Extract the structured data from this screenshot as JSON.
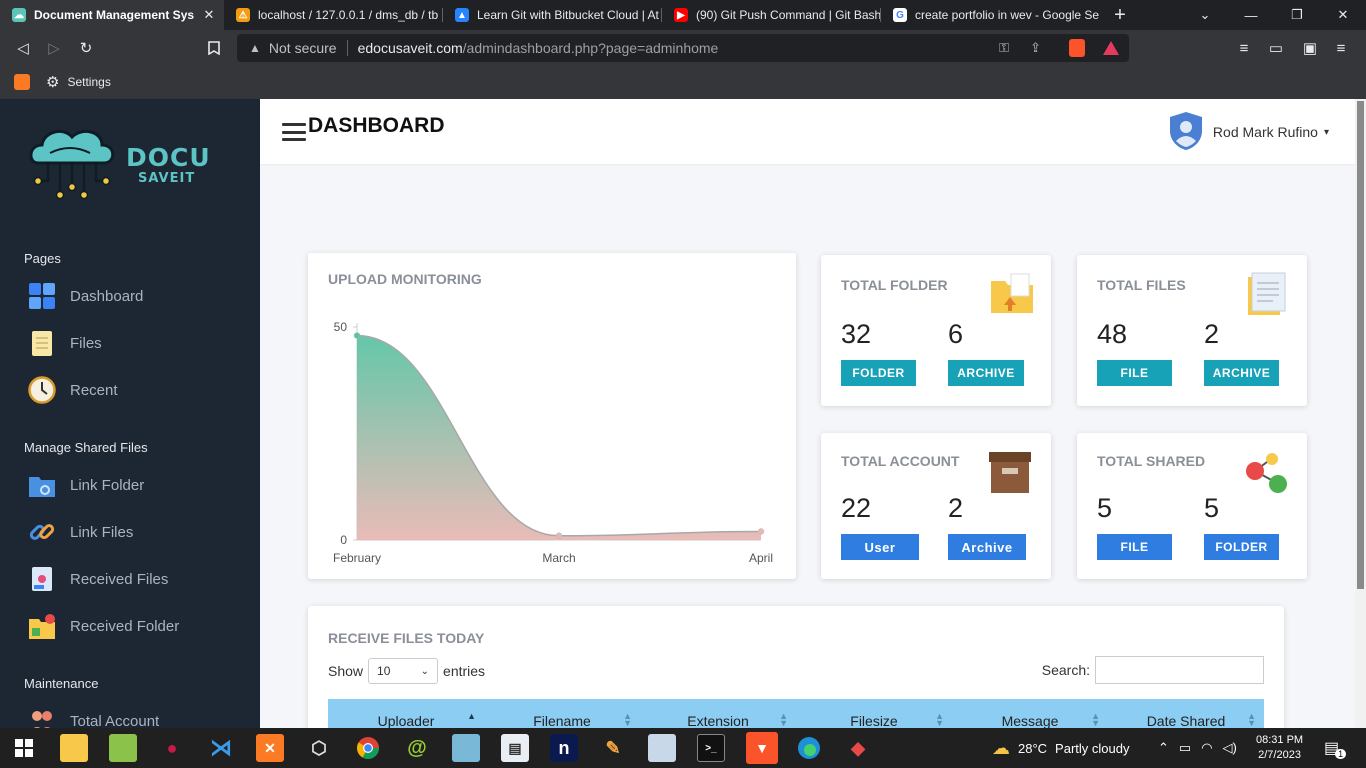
{
  "browser": {
    "tabs": [
      {
        "title": "Document Management Syste",
        "active": true,
        "icon": "cloud-favicon",
        "color": "#5cc4b8"
      },
      {
        "title": "localhost / 127.0.0.1 / dms_db / tb",
        "active": false,
        "icon": "phpmyadmin-favicon",
        "color": "#f39c12"
      },
      {
        "title": "Learn Git with Bitbucket Cloud | At",
        "active": false,
        "icon": "atlassian-favicon",
        "color": "#2684ff"
      },
      {
        "title": "(90) Git Push Command | Git Bash",
        "active": false,
        "icon": "youtube-favicon",
        "color": "#ff0000"
      },
      {
        "title": "create portfolio in wev - Google Se",
        "active": false,
        "icon": "google-favicon",
        "color": "#ffffff"
      }
    ],
    "not_secure": "Not secure",
    "url_host": "edocusaveit.com",
    "url_path": "/admindashboard.php?page=adminhome",
    "bookmarks": [
      {
        "label": "",
        "icon": "xampp-icon"
      },
      {
        "label": "Settings",
        "icon": "gear-icon"
      }
    ]
  },
  "sidebar": {
    "logo_line1": "DOCU",
    "logo_line2": "SAVEIT",
    "sections": [
      {
        "heading": "Pages",
        "items": [
          {
            "label": "Dashboard",
            "icon": "dashboard-icon"
          },
          {
            "label": "Files",
            "icon": "files-icon"
          },
          {
            "label": "Recent",
            "icon": "clock-icon"
          }
        ]
      },
      {
        "heading": "Manage Shared Files",
        "items": [
          {
            "label": "Link Folder",
            "icon": "link-folder-icon"
          },
          {
            "label": "Link Files",
            "icon": "link-icon"
          },
          {
            "label": "Received Files",
            "icon": "received-files-icon"
          },
          {
            "label": "Received Folder",
            "icon": "received-folder-icon"
          }
        ]
      },
      {
        "heading": "Maintenance",
        "items": [
          {
            "label": "Total Account",
            "icon": "users-icon"
          }
        ]
      }
    ]
  },
  "topnav": {
    "user_name": "Rod Mark Rufino"
  },
  "dashboard": {
    "title": "DASHBOARD",
    "upload_card": {
      "title": "UPLOAD MONITORING"
    },
    "stats": [
      {
        "title": "TOTAL FOLDER",
        "icon": "folder-upload-icon",
        "left": {
          "value": "32",
          "label": "FOLDER"
        },
        "right": {
          "value": "6",
          "label": "ARCHIVE"
        },
        "pill_color": "#17a2b8"
      },
      {
        "title": "TOTAL FILES",
        "icon": "documents-icon",
        "left": {
          "value": "48",
          "label": "FILE"
        },
        "right": {
          "value": "2",
          "label": "ARCHIVE"
        },
        "pill_color": "#17a2b8"
      },
      {
        "title": "TOTAL ACCOUNT",
        "icon": "archive-box-icon",
        "left": {
          "value": "22",
          "label": "User"
        },
        "right": {
          "value": "2",
          "label": "Archive"
        },
        "pill_color": "#2f7de1"
      },
      {
        "title": "TOTAL SHARED",
        "icon": "share-nodes-icon",
        "left": {
          "value": "5",
          "label": "FILE"
        },
        "right": {
          "value": "5",
          "label": "FOLDER"
        },
        "pill_color": "#2f7de1"
      }
    ],
    "table": {
      "title": "RECEIVE FILES TODAY",
      "show_label": "Show",
      "entries_value": "10",
      "entries_label": "entries",
      "search_label": "Search:",
      "columns": [
        "Uploader",
        "Filename",
        "Extension",
        "Filesize",
        "Message",
        "Date Shared"
      ]
    }
  },
  "chart_data": {
    "type": "area",
    "title": "",
    "categories": [
      "February",
      "March",
      "April"
    ],
    "values": [
      48,
      1,
      2
    ],
    "ylim": [
      0,
      50
    ],
    "ytick_labels": [
      "0",
      "50"
    ],
    "fill_gradient": [
      "#5cc4a5",
      "#e8b8b4"
    ],
    "grid": false,
    "legend": "none"
  },
  "taskbar": {
    "weather_temp": "28°C",
    "weather_text": "Partly cloudy",
    "time": "08:31 PM",
    "date": "2/7/2023",
    "notification_count": "1",
    "apps": [
      "file-explorer-icon",
      "notepad-icon",
      "raspberry-icon",
      "vscode-icon",
      "xampp-icon",
      "cube-icon",
      "chrome-icon",
      "snail-icon",
      "glass-icon",
      "document-icon",
      "n-icon",
      "paint-icon",
      "monitor-icon",
      "terminal-icon",
      "brave-icon",
      "edge-icon",
      "git-icon"
    ]
  }
}
